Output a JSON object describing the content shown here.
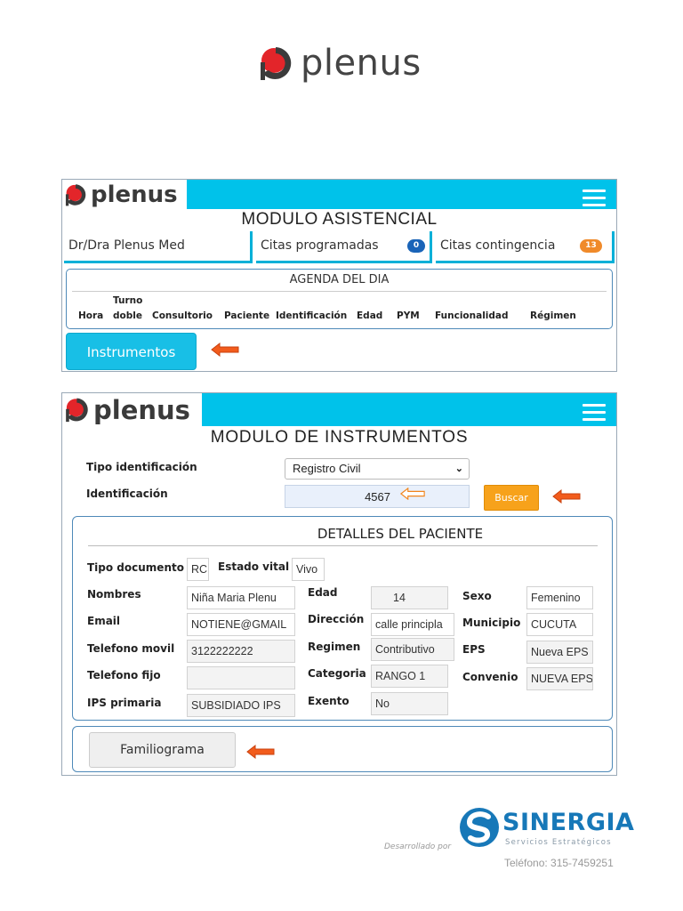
{
  "brand": {
    "name": "plenus",
    "red": "#e3252a",
    "dark": "#3b3b3b",
    "cyan": "#00c2ea",
    "orange": "#f7a21b"
  },
  "screen1": {
    "module_title": "MODULO ASISTENCIAL",
    "doctor": "Dr/Dra Plenus Med",
    "citas_programadas": {
      "label": "Citas programadas",
      "count": "0",
      "color": "#1a64b8"
    },
    "citas_contingencia": {
      "label": "Citas contingencia",
      "count": "13",
      "color": "#f08a2a"
    },
    "agenda": {
      "title": "AGENDA DEL DIA",
      "columns": [
        "Hora",
        "Turno",
        "doble",
        "Consultorio",
        "Paciente",
        "Identificación",
        "Edad",
        "PYM",
        "Funcionalidad",
        "Régimen"
      ]
    },
    "instrumentos_label": "Instrumentos"
  },
  "screen2": {
    "module_title": "MODULO DE INSTRUMENTOS",
    "tipo_identificacion_label": "Tipo identificación",
    "tipo_identificacion_value": "Registro Civil",
    "identificacion_label": "Identificación",
    "identificacion_value": "4567",
    "buscar_label": "Buscar",
    "details": {
      "title": "DETALLES DEL PACIENTE",
      "tipo_documento": {
        "label": "Tipo documento",
        "value": "RC"
      },
      "estado_vital": {
        "label": "Estado vital",
        "value": "Vivo"
      },
      "nombres": {
        "label": "Nombres",
        "value": "Niña Maria  Plenu"
      },
      "edad": {
        "label": "Edad",
        "value": "14"
      },
      "sexo": {
        "label": "Sexo",
        "value": "Femenino"
      },
      "email": {
        "label": "Email",
        "value": "NOTIENE@GMAIL"
      },
      "direccion": {
        "label": "Dirección",
        "value": "calle principla"
      },
      "municipio": {
        "label": "Municipio",
        "value": "CUCUTA"
      },
      "telefono_movil": {
        "label": "Telefono movil",
        "value": "3122222222"
      },
      "regimen": {
        "label": "Regimen",
        "value": "Contributivo"
      },
      "eps": {
        "label": "EPS",
        "value": "Nueva EPS"
      },
      "telefono_fijo": {
        "label": "Telefono fijo",
        "value": ""
      },
      "categoria": {
        "label": "Categoria",
        "value": "RANGO 1"
      },
      "convenio": {
        "label": "Convenio",
        "value": "NUEVA EPS"
      },
      "ips_primaria": {
        "label": "IPS primaria",
        "value": "SUBSIDIADO IPS"
      },
      "exento": {
        "label": "Exento",
        "value": "No"
      }
    },
    "familiograma_label": "Familiograma"
  },
  "footer": {
    "developed_by": "Desarrollado por",
    "company": "SINERGIA",
    "company_sub": "Servicios Estratégicos",
    "phone": "Teléfono: 315-7459251",
    "company_color": "#1778b8"
  }
}
